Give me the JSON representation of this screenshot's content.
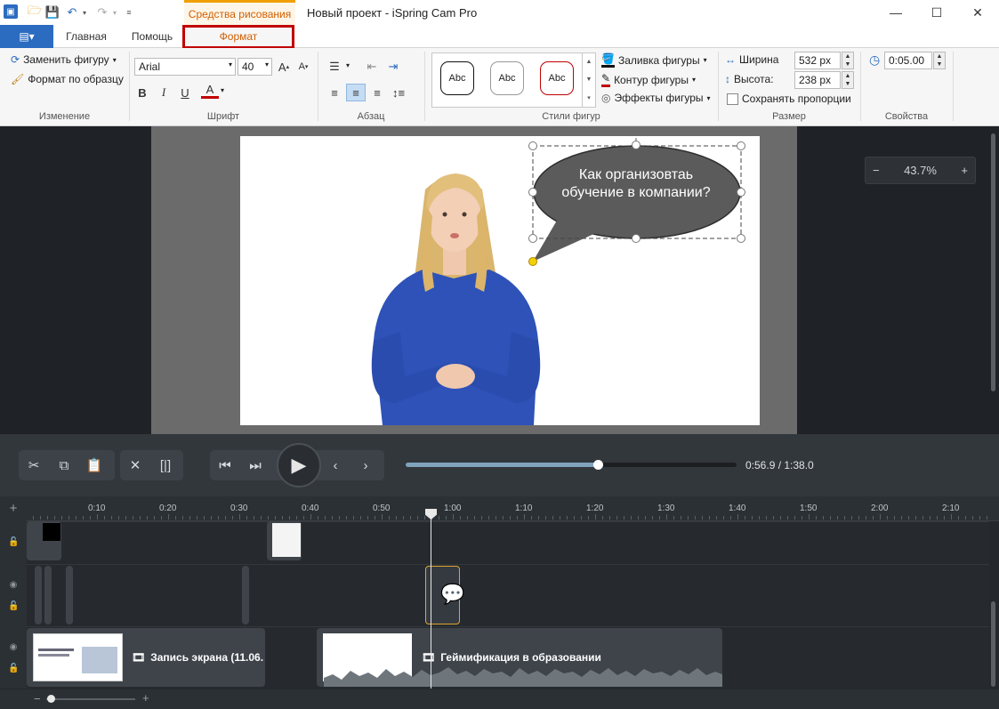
{
  "titlebar": {
    "context_tab_group": "Средства рисования",
    "window_title": "Новый проект - iSpring Cam Pro",
    "minimize": "—",
    "maximize": "☐",
    "close": "✕"
  },
  "tabs": {
    "file_glyph": "▤▾",
    "home": "Главная",
    "help": "Помощь",
    "format": "Формат"
  },
  "ribbon": {
    "change": {
      "replace_shape": "Заменить фигуру",
      "format_painter": "Формат по образцу",
      "label": "Изменение"
    },
    "font": {
      "family": "Arial",
      "size": "40",
      "bold": "B",
      "italic": "I",
      "underline": "U",
      "color_glyph": "A",
      "label": "Шрифт"
    },
    "paragraph": {
      "label": "Абзац"
    },
    "shape_styles": {
      "samples": [
        "Abc",
        "Abc",
        "Abc"
      ],
      "fill": "Заливка фигуры",
      "outline": "Контур фигуры",
      "effects": "Эффекты фигуры",
      "label": "Стили фигур"
    },
    "size": {
      "width_label": "Ширина",
      "width_value": "532 px",
      "height_label": "Высота:",
      "height_value": "238 px",
      "keep_ratio": "Сохранять пропорции",
      "label": "Размер"
    },
    "properties": {
      "duration": "0:05.00",
      "label": "Свойства"
    }
  },
  "canvas": {
    "callout_text": "Как организовтаь обучение в компании?",
    "zoom_minus": "−",
    "zoom_value": "43.7%",
    "zoom_plus": "+"
  },
  "transport": {
    "time": "0:56.9 / 1:38.0",
    "progress": 0.58
  },
  "timeline": {
    "ticks": [
      "0:10",
      "0:20",
      "0:30",
      "0:40",
      "0:50",
      "1:00",
      "1:10",
      "1:20",
      "1:30",
      "1:40",
      "1:50",
      "2:00",
      "2:10"
    ],
    "clip_screen_recording": "Запись экрана (11.06.",
    "clip_gamification": "Геймификация в образовании",
    "add_track": "+",
    "zoom_minus": "−",
    "zoom_plus": "+"
  },
  "colors": {
    "accent_orange": "#d25e00",
    "highlight_red": "#c00000",
    "file_blue": "#2b6cc0",
    "timeline_bg": "#24282c"
  }
}
